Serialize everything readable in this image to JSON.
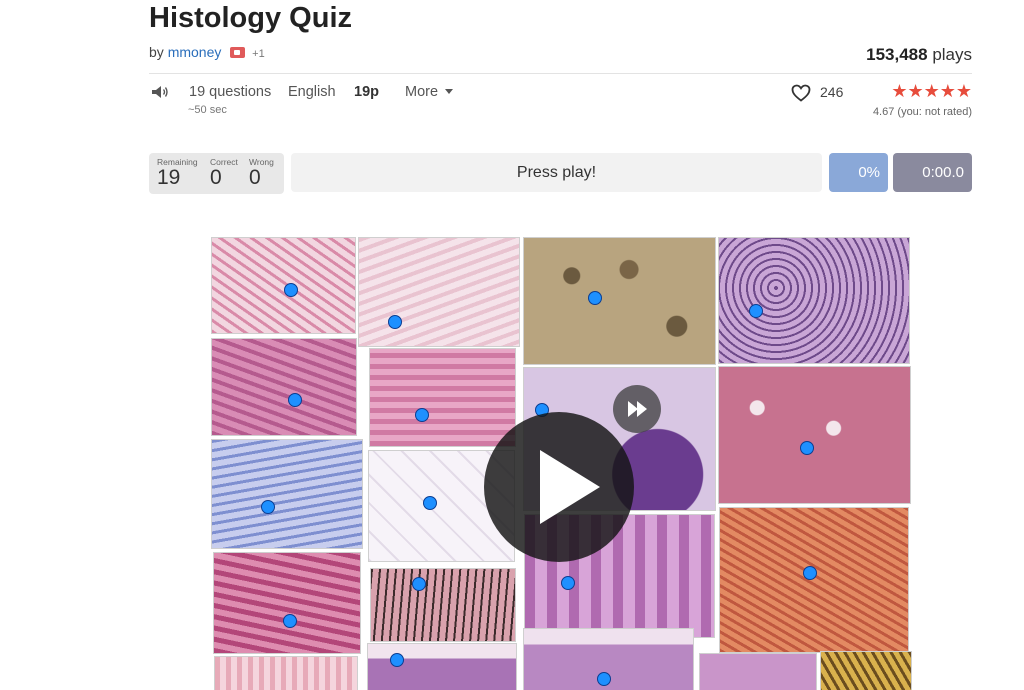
{
  "quiz": {
    "title": "Histology Quiz",
    "by_prefix": "by",
    "author": "mmoney",
    "coauthors": "+1",
    "plays_count": "153,488",
    "plays_label": "plays"
  },
  "meta": {
    "questions": "19 questions",
    "duration": "~50 sec",
    "language": "English",
    "points": "19p",
    "more_label": "More"
  },
  "social": {
    "likes": "246",
    "stars": "★★★★★",
    "rating": "4.67 (you: not rated)"
  },
  "score": {
    "remaining_label": "Remaining",
    "remaining": "19",
    "correct_label": "Correct",
    "correct": "0",
    "wrong_label": "Wrong",
    "wrong": "0"
  },
  "controls": {
    "press_play": "Press play!",
    "percent": "0%",
    "timer": "0:00.0"
  },
  "colors": {
    "accent_blue": "#2a6ebb",
    "stars": "#e74c3c",
    "percent_bg": "#8aa8d8",
    "timer_bg": "#8a8a9e",
    "marker": "#1e90ff"
  },
  "icons": {
    "speaker": "speaker-icon",
    "heart": "heart-icon",
    "caret": "chevron-down-icon",
    "play": "play-icon",
    "fast_forward": "fast-forward-icon"
  }
}
